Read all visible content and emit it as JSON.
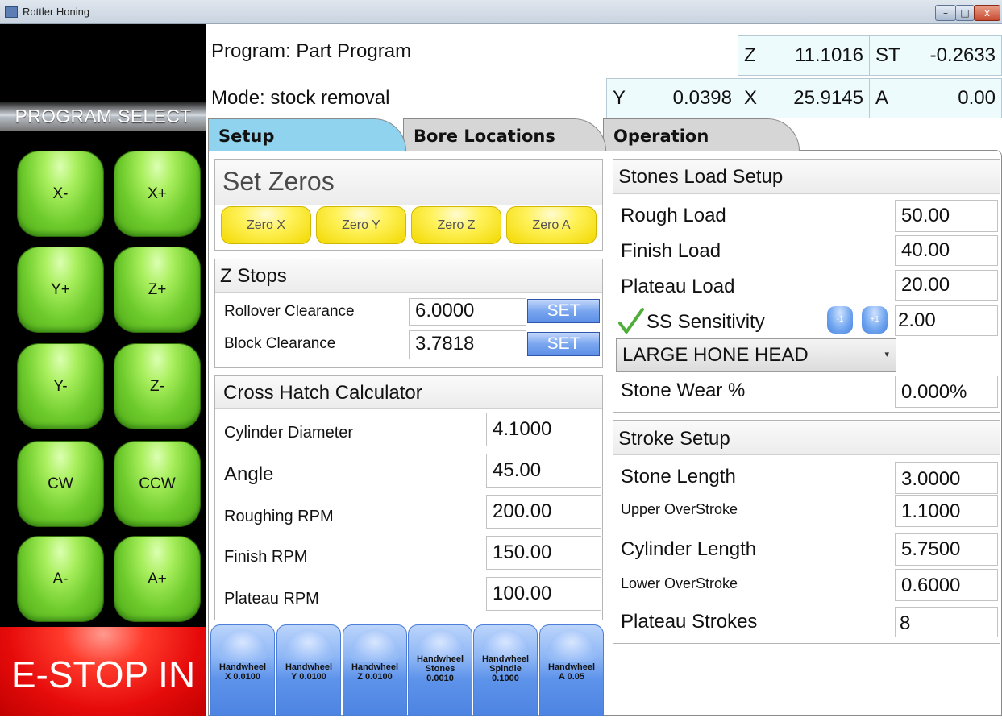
{
  "window": {
    "title": "Rottler Honing",
    "min_glyph": "–",
    "max_glyph": "□",
    "close_glyph": "x"
  },
  "left": {
    "program_select": "PROGRAM SELECT",
    "jog": [
      "X-",
      "X+",
      "Y+",
      "Z+",
      "Y-",
      "Z-",
      "CW",
      "CCW",
      "A-",
      "A+"
    ],
    "estop": "E-STOP IN"
  },
  "header": {
    "program": "Program: Part Program",
    "mode": "Mode: stock removal",
    "axes": {
      "z": {
        "name": "Z",
        "value": "11.1016"
      },
      "st": {
        "name": "ST",
        "value": "-0.2633"
      },
      "y": {
        "name": "Y",
        "value": "0.0398"
      },
      "x": {
        "name": "X",
        "value": "25.9145"
      },
      "a": {
        "name": "A",
        "value": "0.00"
      }
    }
  },
  "tabs": {
    "setup": "Setup",
    "bore": "Bore Locations",
    "operation": "Operation"
  },
  "set_zeros": {
    "title": "Set Zeros",
    "buttons": [
      "Zero X",
      "Zero Y",
      "Zero Z",
      "Zero A"
    ]
  },
  "z_stops": {
    "title": "Z Stops",
    "set_label": "SET",
    "rows": [
      {
        "label": "Rollover Clearance",
        "value": "6.0000"
      },
      {
        "label": "Block Clearance",
        "value": "3.7818"
      }
    ]
  },
  "cross_hatch": {
    "title": "Cross Hatch Calculator",
    "rows": [
      {
        "label": "Cylinder Diameter",
        "value": "4.1000"
      },
      {
        "label": "Angle",
        "value": "45.00"
      },
      {
        "label": "Roughing RPM",
        "value": "200.00"
      },
      {
        "label": "Finish RPM",
        "value": "150.00"
      },
      {
        "label": "Plateau RPM",
        "value": "100.00"
      }
    ]
  },
  "stones_load": {
    "title": "Stones Load Setup",
    "rough_label": "Rough Load",
    "rough_value": "50.00",
    "finish_label": "Finish Load",
    "finish_value": "40.00",
    "plateau_label": "Plateau Load",
    "plateau_value": "20.00",
    "ss_label": "SS Sensitivity",
    "ss_value": "2.00",
    "minus_label": "-1",
    "plus_label": "+1",
    "head_select": "LARGE HONE HEAD",
    "wear_label": "Stone Wear %",
    "wear_value": "0.000%"
  },
  "stroke": {
    "title": "Stroke Setup",
    "rows": [
      {
        "label": "Stone Length",
        "value": "3.0000"
      },
      {
        "label": "Upper OverStroke",
        "value": "1.1000"
      },
      {
        "label": "Cylinder Length",
        "value": "5.7500"
      },
      {
        "label": "Lower OverStroke",
        "value": "0.6000"
      },
      {
        "label": "Plateau Strokes",
        "value": "8"
      }
    ]
  },
  "handwheels": [
    {
      "line1": "Handwheel",
      "line2": "X 0.0100",
      "line3": ""
    },
    {
      "line1": "Handwheel",
      "line2": "Y 0.0100",
      "line3": ""
    },
    {
      "line1": "Handwheel",
      "line2": "Z 0.0100",
      "line3": ""
    },
    {
      "line1": "Handwheel",
      "line2": "Stones",
      "line3": "0.0010"
    },
    {
      "line1": "Handwheel",
      "line2": "Spindle",
      "line3": "0.1000"
    },
    {
      "line1": "Handwheel",
      "line2": "A 0.05",
      "line3": ""
    }
  ],
  "colors": {
    "jog_green": "#6ecb2c",
    "estop_red": "#e60b0b",
    "tab_active": "#8fd3ef",
    "zero_yellow": "#fff25a",
    "set_blue": "#5c8fe6",
    "handwheel_blue": "#5e93ea",
    "readout_bg": "#eefbfd"
  },
  "icons": {
    "check": "check-icon",
    "dropdown": "chevron-down-icon",
    "app": "app-icon"
  }
}
